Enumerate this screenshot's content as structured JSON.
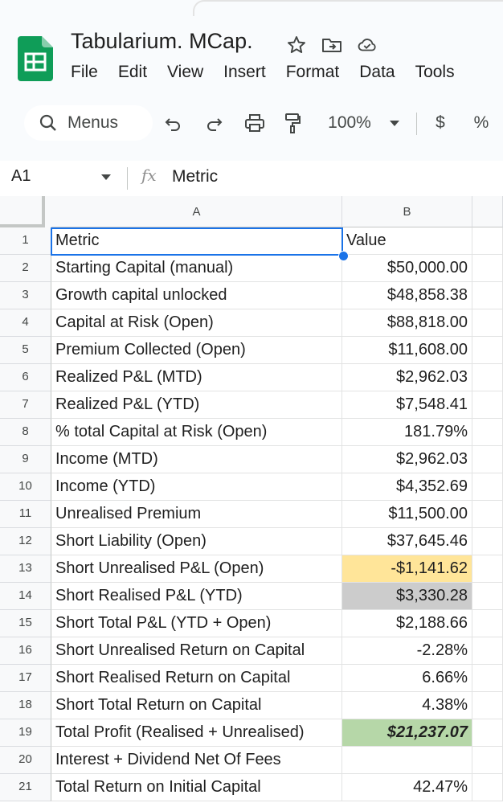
{
  "app": {
    "title": "Tabularium. MCap.",
    "menu": [
      "File",
      "Edit",
      "View",
      "Insert",
      "Format",
      "Data",
      "Tools"
    ],
    "title_icons": [
      "star-icon",
      "move-to-folder-icon",
      "cloud-saved-icon"
    ]
  },
  "toolbar": {
    "search_label": "Menus",
    "zoom": "100%",
    "currency_label": "$",
    "percent_label": "%",
    "icons": [
      "search-icon",
      "undo-icon",
      "redo-icon",
      "print-icon",
      "paint-format-icon",
      "zoom-dropdown-icon"
    ]
  },
  "formula_bar": {
    "name_box": "A1",
    "fx_label": "fx",
    "content": "Metric"
  },
  "sheet": {
    "column_headers": [
      "A",
      "B"
    ],
    "rows": [
      {
        "num": "1",
        "a": "Metric",
        "b": "Value"
      },
      {
        "num": "2",
        "a": "Starting Capital (manual)",
        "b": "$50,000.00"
      },
      {
        "num": "3",
        "a": "Growth capital unlocked",
        "b": "$48,858.38"
      },
      {
        "num": "4",
        "a": "Capital at Risk (Open)",
        "b": "$88,818.00"
      },
      {
        "num": "5",
        "a": "Premium Collected (Open)",
        "b": "$11,608.00"
      },
      {
        "num": "6",
        "a": "Realized P&L (MTD)",
        "b": "$2,962.03"
      },
      {
        "num": "7",
        "a": "Realized P&L (YTD)",
        "b": "$7,548.41"
      },
      {
        "num": "8",
        "a": "% total Capital at Risk (Open)",
        "b": "181.79%"
      },
      {
        "num": "9",
        "a": "Income (MTD)",
        "b": "$2,962.03"
      },
      {
        "num": "10",
        "a": "Income (YTD)",
        "b": "$4,352.69"
      },
      {
        "num": "11",
        "a": "Unrealised Premium",
        "b": "$11,500.00"
      },
      {
        "num": "12",
        "a": "Short Liability (Open)",
        "b": "$37,645.46"
      },
      {
        "num": "13",
        "a": "Short Unrealised P&L (Open)",
        "b": "-$1,141.62",
        "fill": "#ffe599"
      },
      {
        "num": "14",
        "a": "Short Realised P&L (YTD)",
        "b": "$3,330.28",
        "fill": "#cccccc"
      },
      {
        "num": "15",
        "a": "Short Total P&L (YTD + Open)",
        "b": "$2,188.66"
      },
      {
        "num": "16",
        "a": "Short Unrealised Return on Capital",
        "b": "-2.28%"
      },
      {
        "num": "17",
        "a": "Short Realised Return on Capital",
        "b": "6.66%"
      },
      {
        "num": "18",
        "a": "Short Total Return on Capital",
        "b": "4.38%"
      },
      {
        "num": "19",
        "a": "Total Profit (Realised + Unrealised)",
        "b": "$21,237.07",
        "fill": "#b6d7a8",
        "bold_italic": true
      },
      {
        "num": "20",
        "a": "Interest + Dividend Net Of Fees",
        "b": ""
      },
      {
        "num": "21",
        "a": "Total Return on Initial Capital",
        "b": "42.47%"
      }
    ],
    "selected_cell": "A1",
    "selection_color": "#1a73e8"
  }
}
